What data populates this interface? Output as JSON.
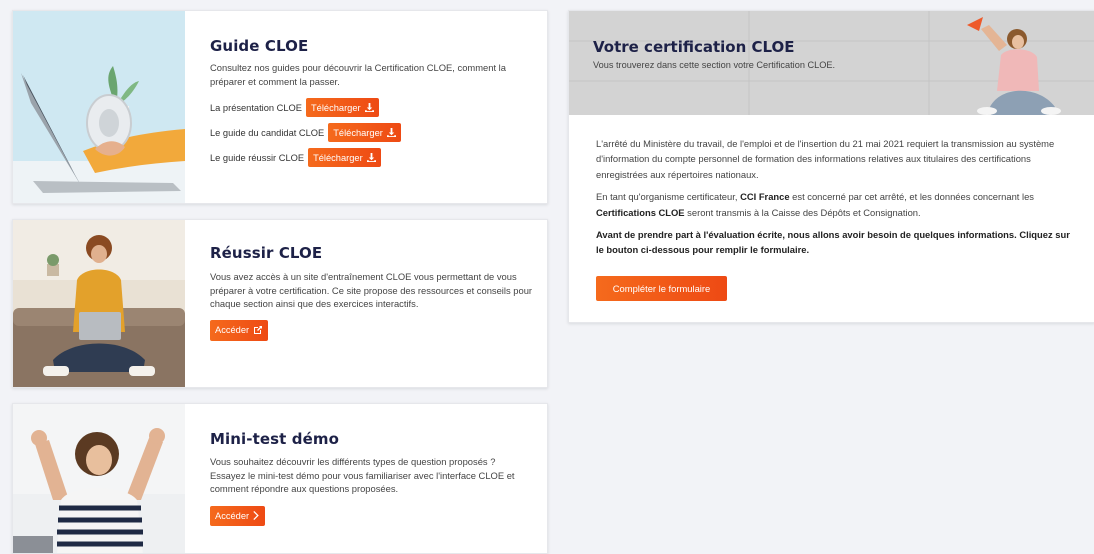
{
  "guide": {
    "title": "Guide CLOE",
    "description": "Consultez nos guides pour découvrir la Certification CLOE, comment la préparer et comment la passer.",
    "downloads": [
      {
        "label": "La présentation CLOE",
        "button": "Télécharger"
      },
      {
        "label": "Le guide du candidat CLOE",
        "button": "Télécharger"
      },
      {
        "label": "Le guide réussir CLOE",
        "button": "Télécharger"
      }
    ],
    "icon": "download-icon"
  },
  "reussir": {
    "title": "Réussir CLOE",
    "description": "Vous avez accès à un site d'entraînement CLOE vous permettant de vous préparer à votre certification. Ce site propose des ressources et conseils pour chaque section ainsi que des exercices interactifs.",
    "button": "Accéder",
    "icon": "external-link-icon"
  },
  "minitest": {
    "title": "Mini-test démo",
    "description": "Vous souhaitez découvrir les différents types de question proposés ? Essayez le mini-test démo pour vous familiariser avec l'interface CLOE et comment répondre aux questions proposées.",
    "button": "Accéder",
    "icon": "chevron-right-icon"
  },
  "certification": {
    "title": "Votre certification CLOE",
    "subtitle": "Vous trouverez dans cette section votre Certification CLOE.",
    "para1": "L'arrêté du Ministère du travail, de l'emploi et de l'insertion du 21 mai 2021 requiert la transmission au système d'information du compte personnel de formation des informations relatives aux titulaires des certifications enregistrées aux répertoires nationaux.",
    "para2_a": "En tant qu'organisme certificateur, ",
    "para2_b": "CCI France",
    "para2_c": " est concerné par cet arrêté, et les données concernant les ",
    "para2_d": "Certifications CLOE",
    "para2_e": " seront transmis à la Caisse des Dépôts et Consignation.",
    "para3": "Avant de prendre part à l'évaluation écrite, nous allons avoir besoin de quelques informations. Cliquez sur le bouton ci-dessous pour remplir le formulaire.",
    "cta": "Compléter le formulaire"
  },
  "colors": {
    "accent": "#f0521a",
    "title": "#1d2147",
    "background": "#f2f3f7"
  }
}
